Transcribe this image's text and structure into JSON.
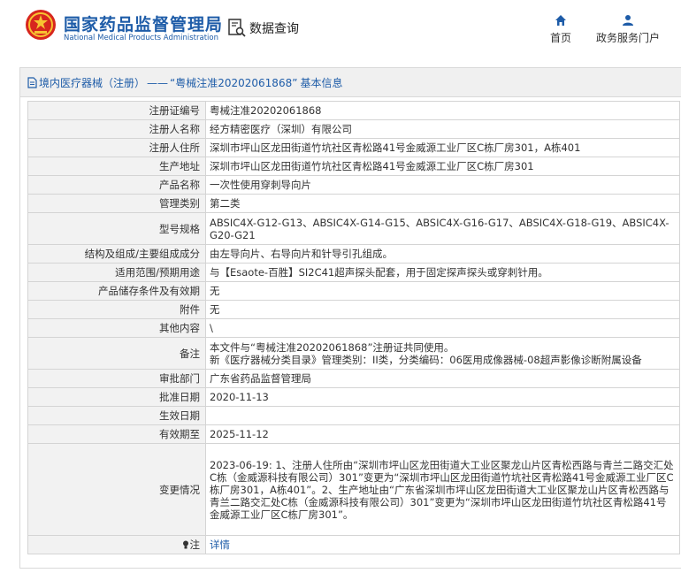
{
  "header": {
    "site_name": "国家药品监督管理局",
    "site_name_en": "National Medical Products Administration",
    "query_label": "数据查询",
    "nav": [
      {
        "label": "首页",
        "icon": "home-icon"
      },
      {
        "label": "政务服务门户",
        "icon": "user-icon"
      }
    ]
  },
  "breadcrumb": {
    "link": "境内医疗器械（注册）",
    "sep": "——",
    "title": "“粤械注准20202061868”",
    "suffix": "基本信息"
  },
  "table": {
    "rows": [
      {
        "label": "注册证编号",
        "value": "粤械注准20202061868"
      },
      {
        "label": "注册人名称",
        "value": "经方精密医疗（深圳）有限公司"
      },
      {
        "label": "注册人住所",
        "value": "深圳市坪山区龙田街道竹坑社区青松路41号金威源工业厂区C栋厂房301，A栋401"
      },
      {
        "label": "生产地址",
        "value": "深圳市坪山区龙田街道竹坑社区青松路41号金威源工业厂区C栋厂房301"
      },
      {
        "label": "产品名称",
        "value": "一次性使用穿刺导向片"
      },
      {
        "label": "管理类别",
        "value": "第二类"
      },
      {
        "label": "型号规格",
        "value": "ABSIC4X-G12-G13、ABSIC4X-G14-G15、ABSIC4X-G16-G17、ABSIC4X-G18-G19、ABSIC4X-G20-G21"
      },
      {
        "label": "结构及组成/主要组成成分",
        "value": "由左导向片、右导向片和针导引孔组成。"
      },
      {
        "label": "适用范围/预期用途",
        "value": "与【Esaote-百胜】SI2C41超声探头配套，用于固定探声探头或穿刺针用。"
      },
      {
        "label": "产品储存条件及有效期",
        "value": "无"
      },
      {
        "label": "附件",
        "value": "无"
      },
      {
        "label": "其他内容",
        "value": "\\"
      },
      {
        "label": "备注",
        "lines": [
          "本文件与“粤械注准20202061868”注册证共同使用。",
          "新《医疗器械分类目录》管理类别：II类，分类编码：06医用成像器械-08超声影像诊断附属设备"
        ]
      },
      {
        "label": "审批部门",
        "value": "广东省药品监督管理局"
      },
      {
        "label": "批准日期",
        "value": "2020-11-13"
      },
      {
        "label": "生效日期",
        "value": ""
      },
      {
        "label": "有效期至",
        "value": "2025-11-12"
      },
      {
        "label": "变更情况",
        "value": "2023-06-19: 1、注册人住所由“深圳市坪山区龙田街道大工业区聚龙山片区青松西路与青兰二路交汇处C栋（金威源科技有限公司）301”变更为“深圳市坪山区龙田街道竹坑社区青松路41号金威源工业厂区C栋厂房301，A栋401”。2、生产地址由“广东省深圳市坪山区龙田街道大工业区聚龙山片区青松西路与青兰二路交汇处C栋（金威源科技有限公司）301”变更为“深圳市坪山区龙田街道竹坑社区青松路41号金威源工业厂区C栋厂房301”。"
      },
      {
        "label": "注",
        "value": "详情"
      }
    ]
  }
}
